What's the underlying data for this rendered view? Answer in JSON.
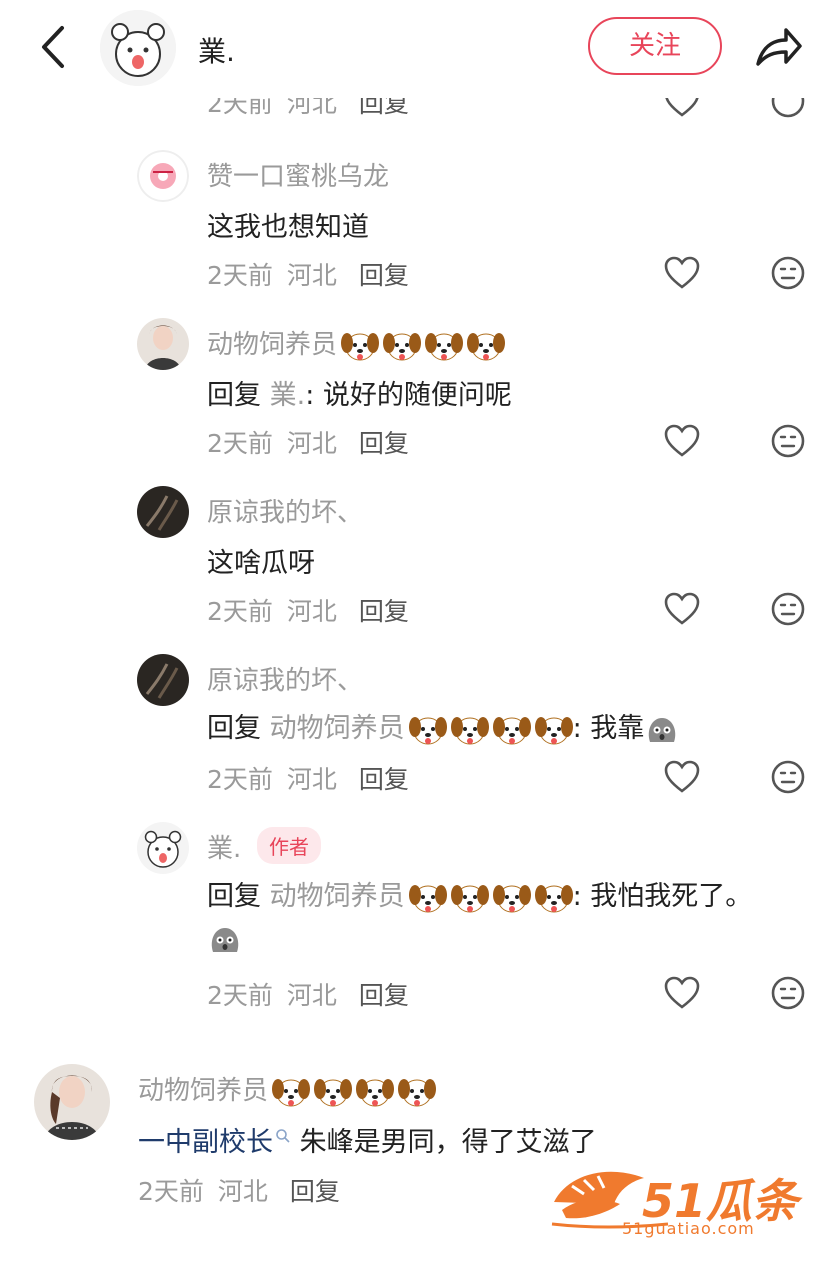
{
  "header": {
    "username": "業.",
    "follow_label": "关注"
  },
  "top_partial": {
    "meta": [
      "2天前",
      "河北",
      "回复"
    ]
  },
  "comments": [
    {
      "name": "赞一口蜜桃乌龙",
      "text": "这我也想知道",
      "time": "2天前",
      "region": "河北",
      "reply": "回复"
    },
    {
      "name": "动物饲养员",
      "reply_prefix": "回复",
      "reply_to": "業.",
      "text": ": 说好的随便问呢",
      "time": "2天前",
      "region": "河北",
      "reply": "回复"
    },
    {
      "name": "原谅我的坏、",
      "text": "这啥瓜呀",
      "time": "2天前",
      "region": "河北",
      "reply": "回复"
    },
    {
      "name": "原谅我的坏、",
      "reply_prefix": "回复",
      "reply_to": "动物饲养员",
      "text": ": 我靠",
      "time": "2天前",
      "region": "河北",
      "reply": "回复"
    },
    {
      "name": "業.",
      "badge": "作者",
      "reply_prefix": "回复",
      "reply_to": "动物饲养员",
      "text": ": 我怕我死了。",
      "time": "2天前",
      "region": "河北",
      "reply": "回复"
    }
  ],
  "top_comment": {
    "name": "动物饲养员",
    "link": "一中副校长",
    "text": " 朱峰是男同，得了艾滋了",
    "time": "2天前",
    "region": "河北",
    "reply": "回复"
  },
  "watermark": {
    "text": "51瓜条",
    "sub": "51guatiao.com"
  },
  "colors": {
    "accent": "#e8455a",
    "muted": "#9a9a9a",
    "link": "#1f3b6b",
    "watermark": "#f07a2e"
  },
  "icons": [
    "back-arrow-icon",
    "share-icon",
    "heart-icon",
    "face-neutral-icon",
    "dog-emoji-icon",
    "rock-emoji-icon",
    "search-icon"
  ]
}
